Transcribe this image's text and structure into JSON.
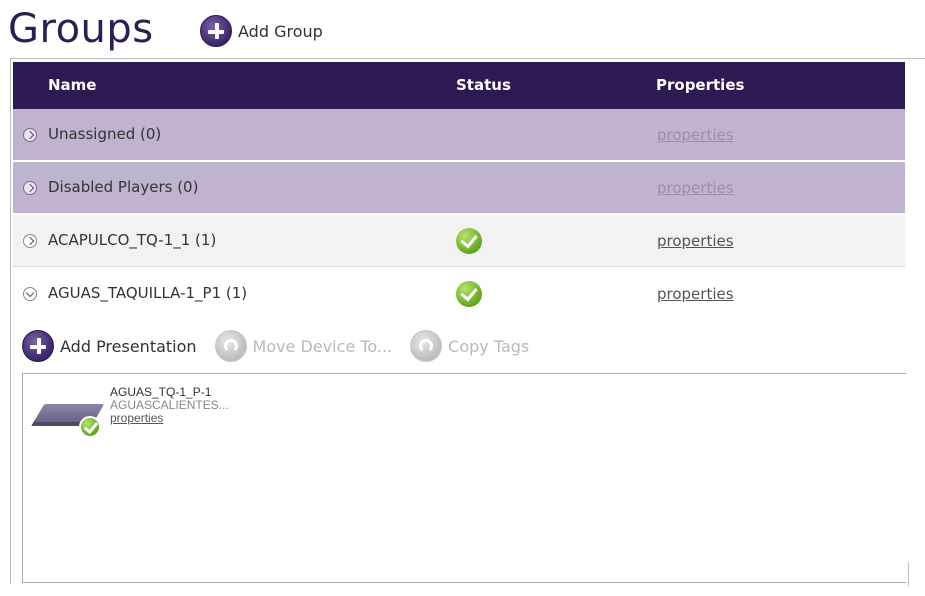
{
  "page": {
    "title": "Groups",
    "add_group_label": "Add Group"
  },
  "table": {
    "columns": {
      "name": "Name",
      "status": "Status",
      "properties": "Properties"
    },
    "rows": [
      {
        "name": "Unassigned (0)",
        "status": "",
        "properties": "properties",
        "kind": "system",
        "expanded": false
      },
      {
        "name": "Disabled Players (0)",
        "status": "",
        "properties": "properties",
        "kind": "system",
        "expanded": false
      },
      {
        "name": "ACAPULCO_TQ-1_1 (1)",
        "status": "ok",
        "properties": "properties",
        "kind": "normal",
        "expanded": false
      },
      {
        "name": "AGUAS_TAQUILLA-1_P1 (1)",
        "status": "ok",
        "properties": "properties",
        "kind": "normal",
        "expanded": true
      }
    ]
  },
  "toolbar": {
    "add_presentation": "Add Presentation",
    "move_device": "Move Device To...",
    "copy_tags": "Copy Tags"
  },
  "device": {
    "name": "AGUAS_TQ-1_P-1",
    "location": "AGUASCALIENTES...",
    "properties": "properties",
    "status": "ok"
  },
  "colors": {
    "header_bg": "#2e1a52",
    "system_row_bg": "#bfb3cf",
    "status_ok": "#6cb31f",
    "title": "#2e1d55"
  }
}
